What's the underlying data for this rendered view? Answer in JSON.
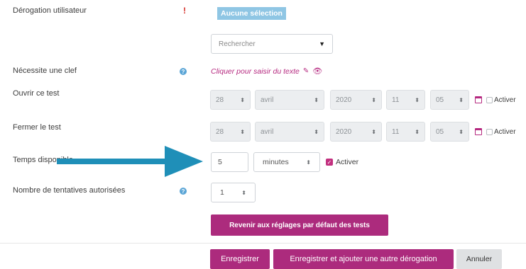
{
  "fields": {
    "derogation": {
      "label": "Dérogation utilisateur",
      "required_icon": "exclamation-icon",
      "badge": "Aucune sélection",
      "search_placeholder": "Rechercher",
      "dropdown_icon": "triangle-down-icon"
    },
    "clef": {
      "label": "Nécessite une clef",
      "help_icon": "question-icon",
      "link_text": "Cliquer pour saisir du texte",
      "pencil_icon": "pencil-icon",
      "eye_icon": "eye-icon"
    },
    "ouvrir": {
      "label": "Ouvrir ce test",
      "day": "28",
      "month": "avril",
      "year": "2020",
      "hour": "11",
      "minute": "05",
      "enable_label": "Activer",
      "enabled": false
    },
    "fermer": {
      "label": "Fermer le test",
      "day": "28",
      "month": "avril",
      "year": "2020",
      "hour": "11",
      "minute": "05",
      "enable_label": "Activer",
      "enabled": false
    },
    "temps": {
      "label": "Temps disponible",
      "value": "5",
      "unit": "minutes",
      "enable_label": "Activer",
      "enabled": true
    },
    "tentatives": {
      "label": "Nombre de tentatives autorisées",
      "help_icon": "question-icon",
      "value": "1"
    }
  },
  "buttons": {
    "reset": "Revenir aux réglages par défaut des tests",
    "save": "Enregistrer",
    "save_add": "Enregistrer et ajouter une autre dérogation",
    "cancel": "Annuler"
  },
  "colors": {
    "accent": "#ac2b7d",
    "arrow": "#1f8fb8",
    "badge": "#8fc6e4"
  }
}
